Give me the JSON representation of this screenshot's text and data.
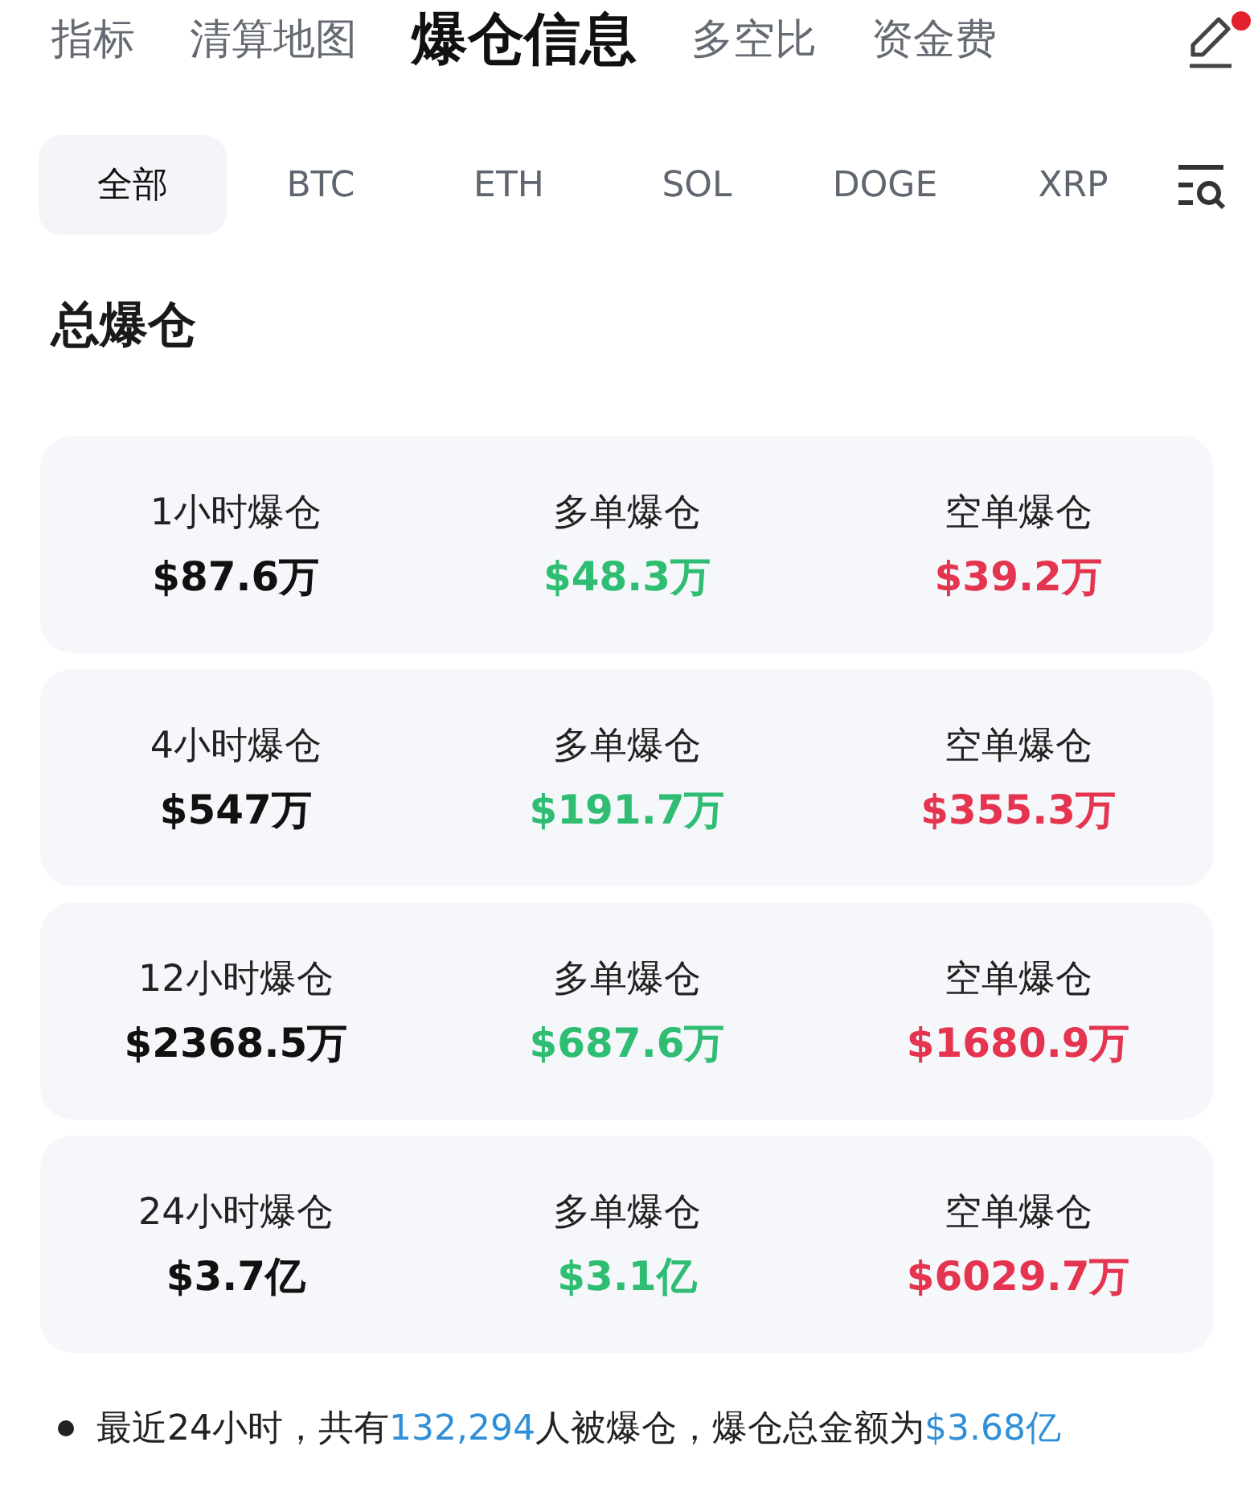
{
  "top_tabs": [
    {
      "label": "指标",
      "selected": false
    },
    {
      "label": "清算地图",
      "selected": false
    },
    {
      "label": "爆仓信息",
      "selected": true
    },
    {
      "label": "多空比",
      "selected": false
    },
    {
      "label": "资金费",
      "selected": false
    }
  ],
  "edit_notification": true,
  "coin_filters": [
    {
      "label": "全部",
      "selected": true
    },
    {
      "label": "BTC",
      "selected": false
    },
    {
      "label": "ETH",
      "selected": false
    },
    {
      "label": "SOL",
      "selected": false
    },
    {
      "label": "DOGE",
      "selected": false
    },
    {
      "label": "XRP",
      "selected": false
    }
  ],
  "section_title": "总爆仓",
  "cards": [
    {
      "total_label": "1小时爆仓",
      "total": "$87.6万",
      "long_label": "多单爆仓",
      "long": "$48.3万",
      "short_label": "空单爆仓",
      "short": "$39.2万"
    },
    {
      "total_label": "4小时爆仓",
      "total": "$547万",
      "long_label": "多单爆仓",
      "long": "$191.7万",
      "short_label": "空单爆仓",
      "short": "$355.3万"
    },
    {
      "total_label": "12小时爆仓",
      "total": "$2368.5万",
      "long_label": "多单爆仓",
      "long": "$687.6万",
      "short_label": "空单爆仓",
      "short": "$1680.9万"
    },
    {
      "total_label": "24小时爆仓",
      "total": "$3.7亿",
      "long_label": "多单爆仓",
      "long": "$3.1亿",
      "short_label": "空单爆仓",
      "short": "$6029.7万"
    }
  ],
  "summary": [
    {
      "text": "最近24小时，共有",
      "highlight": false
    },
    {
      "text": "132,294",
      "highlight": true
    },
    {
      "text": "人被爆仓，爆仓总金额为",
      "highlight": false
    },
    {
      "text": "$3.68亿",
      "highlight": true
    }
  ]
}
